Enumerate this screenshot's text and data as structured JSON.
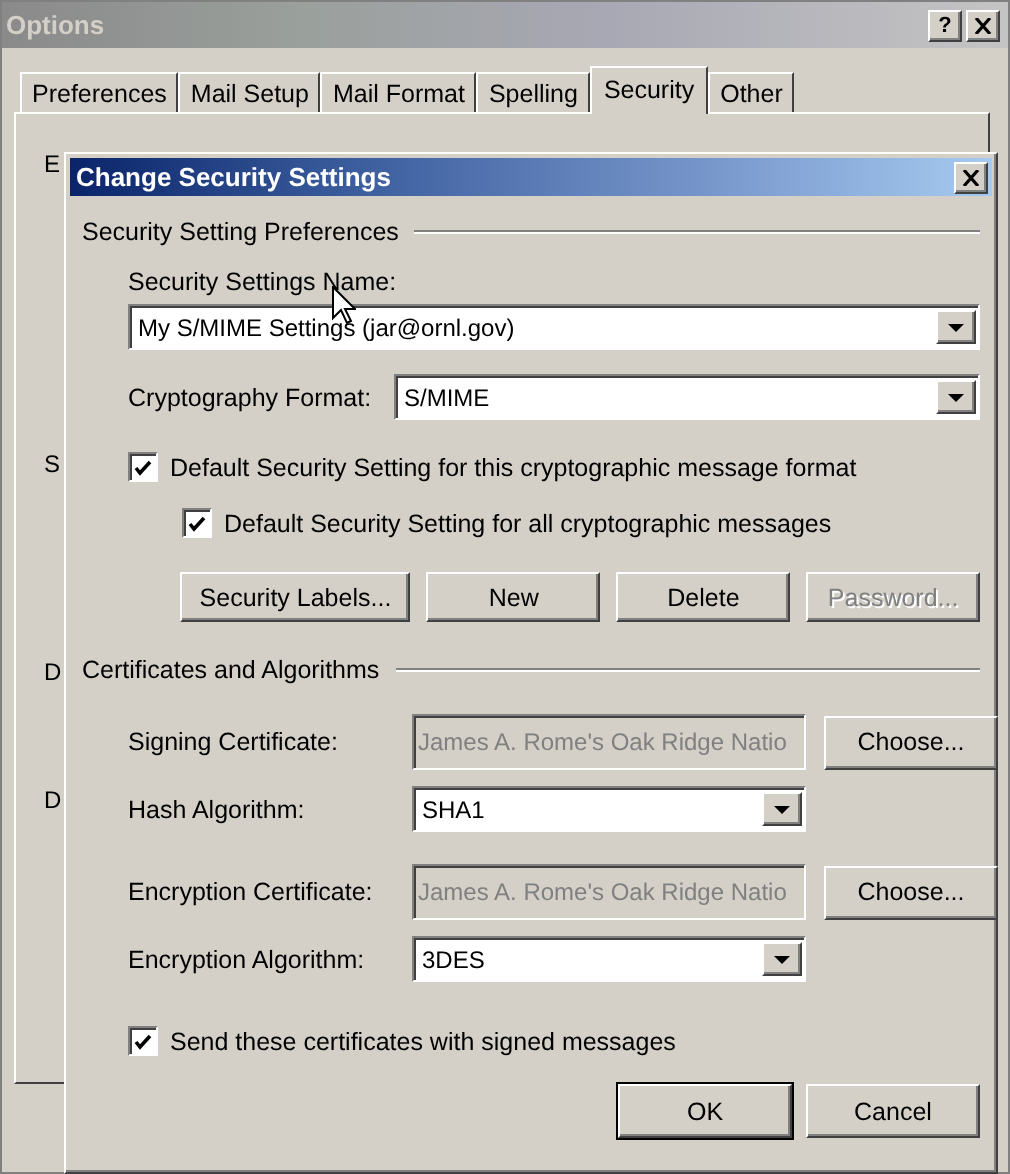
{
  "options_window": {
    "title": "Options",
    "help_button": "?",
    "tabs": [
      {
        "label": "Preferences",
        "selected": false
      },
      {
        "label": "Mail Setup",
        "selected": false
      },
      {
        "label": "Mail Format",
        "selected": false
      },
      {
        "label": "Spelling",
        "selected": false
      },
      {
        "label": "Security",
        "selected": true
      },
      {
        "label": "Other",
        "selected": false
      }
    ],
    "background_fragments": [
      "E",
      "S",
      "D",
      "D"
    ]
  },
  "dialog": {
    "title": "Change Security Settings",
    "preferences": {
      "heading": "Security Setting Preferences",
      "name_label": "Security Settings Name:",
      "name_value": "My S/MIME Settings (jar@ornl.gov)",
      "format_label": "Cryptography Format:",
      "format_value": "S/MIME",
      "checkboxes": [
        {
          "label": "Default Security Setting for this cryptographic message format",
          "checked": true
        },
        {
          "label": "Default Security Setting for all cryptographic messages",
          "checked": true
        }
      ],
      "buttons": [
        {
          "label": "Security Labels...",
          "disabled": false
        },
        {
          "label": "New",
          "disabled": false
        },
        {
          "label": "Delete",
          "disabled": false
        },
        {
          "label": "Password...",
          "disabled": true
        }
      ]
    },
    "certificates": {
      "heading": "Certificates and Algorithms",
      "rows": [
        {
          "kind": "certificate",
          "label": "Signing Certificate:",
          "value": "James A. Rome's Oak Ridge Natio",
          "disabled": true,
          "button": "Choose..."
        },
        {
          "kind": "dropdown",
          "label": "Hash Algorithm:",
          "value": "SHA1"
        },
        {
          "kind": "certificate",
          "label": "Encryption Certificate:",
          "value": "James A. Rome's Oak Ridge Natio",
          "disabled": true,
          "button": "Choose..."
        },
        {
          "kind": "dropdown",
          "label": "Encryption Algorithm:",
          "value": "3DES"
        }
      ],
      "send_checkbox": {
        "label": "Send these certificates with signed messages",
        "checked": true
      }
    },
    "buttons": [
      "OK",
      "Cancel"
    ]
  }
}
